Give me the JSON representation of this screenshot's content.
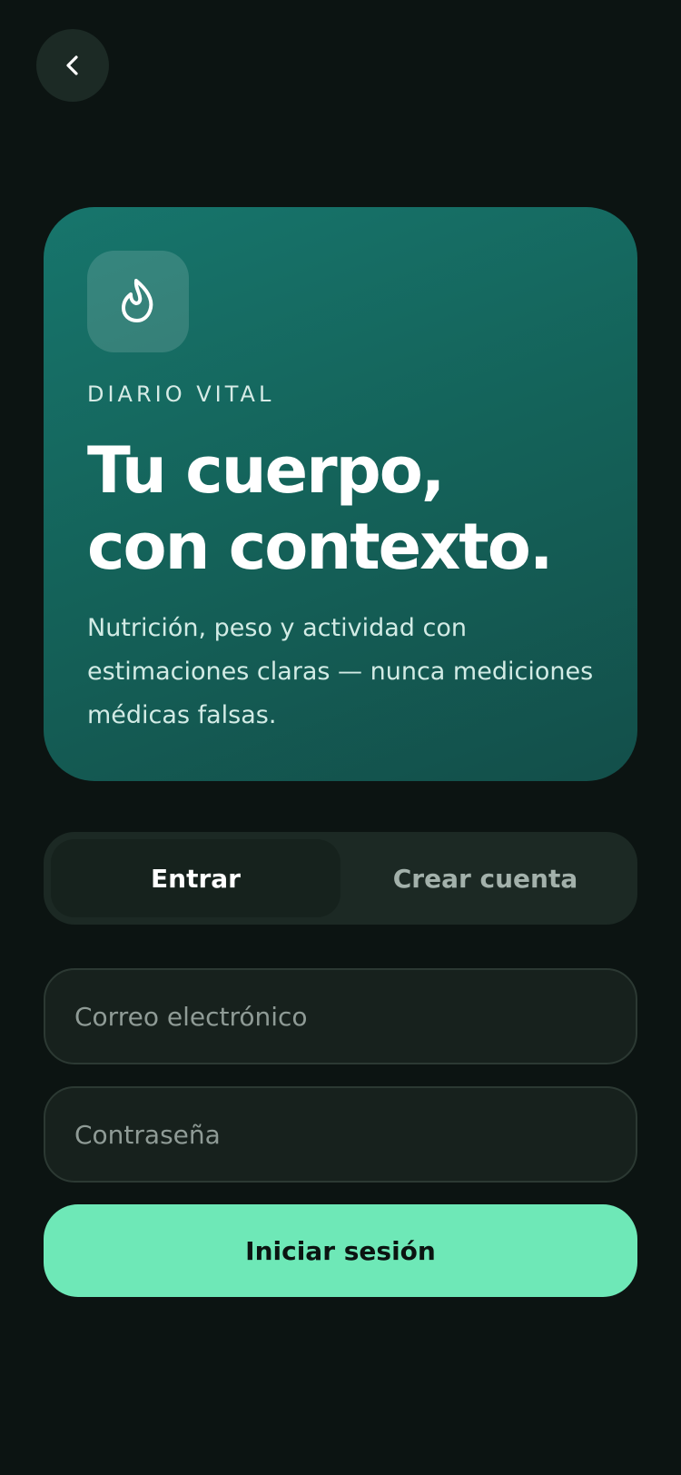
{
  "icons": {
    "back": "chevron-left-icon",
    "brand": "flame-icon"
  },
  "colors": {
    "background": "#0c1412",
    "hero_gradient_start": "#17756c",
    "hero_gradient_end": "#134f4a",
    "accent": "#6ee8b7"
  },
  "hero": {
    "eyebrow": "DIARIO VITAL",
    "title_line1": "Tu cuerpo,",
    "title_line2": "con contexto.",
    "subtitle": "Nutrición, peso y actividad con estimaciones claras — nunca mediciones médicas falsas."
  },
  "auth_tabs": {
    "selected": "Entrar",
    "login_label": "Entrar",
    "signup_label": "Crear cuenta"
  },
  "form": {
    "email_placeholder": "Correo electrónico",
    "email_value": "",
    "password_placeholder": "Contraseña",
    "password_value": "",
    "submit_label": "Iniciar sesión"
  }
}
